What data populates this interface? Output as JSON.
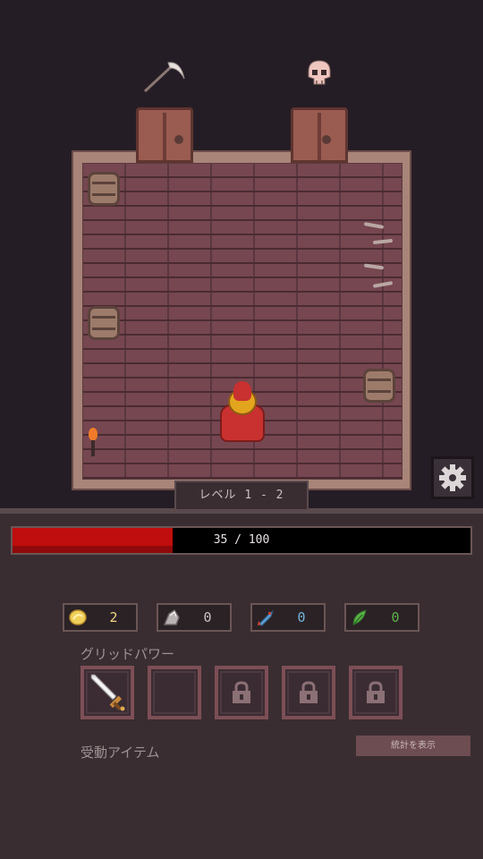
{
  "level": {
    "label": "レベル 1 - 2"
  },
  "health": {
    "current": 35,
    "max": 100,
    "text": "35 / 100",
    "fraction": 0.35,
    "fill_color": "#c00d0d"
  },
  "resources": [
    {
      "name": "gold-coin",
      "icon": "coin-icon",
      "value": "2",
      "color": "#f1d784"
    },
    {
      "name": "ore",
      "icon": "ore-icon",
      "value": "0",
      "color": "#c9c2c2"
    },
    {
      "name": "fish",
      "icon": "fish-icon",
      "value": "0",
      "color": "#73b4d8"
    },
    {
      "name": "herb",
      "icon": "leaf-icon",
      "value": "0",
      "color": "#5bb24a"
    }
  ],
  "grid_power": {
    "label": "グリッドパワー",
    "slots": [
      {
        "state": "equipped",
        "icon": "sword-icon"
      },
      {
        "state": "empty",
        "icon": ""
      },
      {
        "state": "locked",
        "icon": "lock-icon"
      },
      {
        "state": "locked",
        "icon": "lock-icon"
      },
      {
        "state": "locked",
        "icon": "lock-icon"
      }
    ]
  },
  "passive_items": {
    "label": "受動アイテム"
  },
  "stats_button": {
    "label": "統計を表示"
  },
  "settings": {
    "icon": "gear-icon"
  },
  "room": {
    "exits": [
      {
        "icon": "scythe-icon"
      },
      {
        "icon": "skull-icon"
      }
    ]
  }
}
